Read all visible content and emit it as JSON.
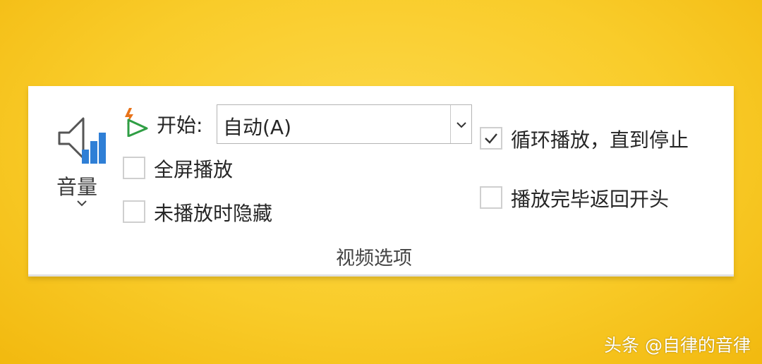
{
  "volume": {
    "label": "音量",
    "icon": "speaker-volume-icon"
  },
  "start": {
    "label": "开始:",
    "icon": "start-trigger-icon",
    "selected_value": "自动(A)"
  },
  "options": {
    "fullscreen": {
      "label": "全屏播放",
      "checked": false
    },
    "hide_while_not_playing": {
      "label": "未播放时隐藏",
      "checked": false
    },
    "loop_until_stopped": {
      "label": "循环播放，直到停止",
      "checked": true
    },
    "rewind_after_playing": {
      "label": "播放完毕返回开头",
      "checked": false
    }
  },
  "group_label": "视频选项",
  "watermark": "头条 @自律的音律",
  "colors": {
    "background": "#f9cc2a",
    "panel": "#ffffff",
    "volume_bars": "#2f7fd6",
    "start_bolt": "#e8731a",
    "start_play": "#2f9e44"
  }
}
